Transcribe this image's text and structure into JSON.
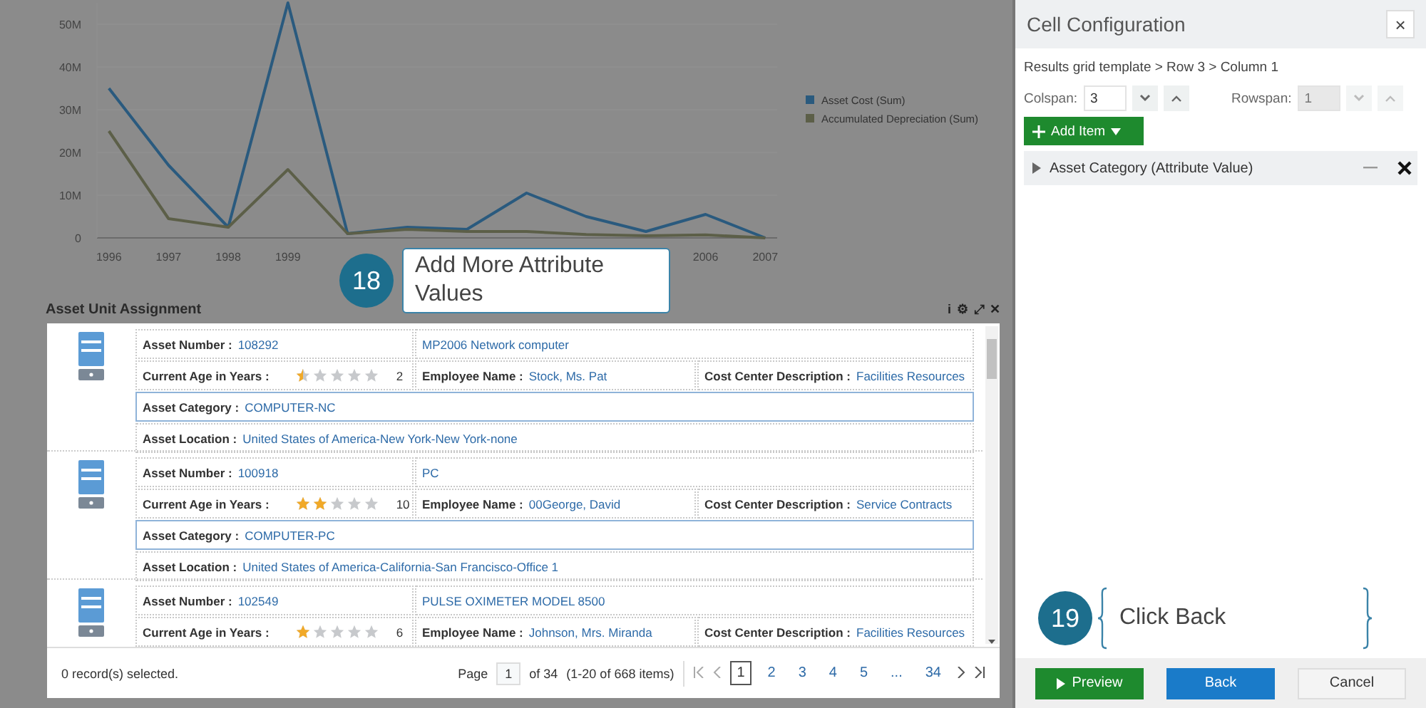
{
  "chart": {
    "chart_data": {
      "type": "line",
      "x": [
        1996,
        1997,
        1998,
        1999,
        2000,
        2001,
        2002,
        2003,
        2004,
        2005,
        2006,
        2007
      ],
      "xticks": [
        1996,
        1997,
        1998,
        1999,
        2006,
        2007
      ],
      "yticks": [
        {
          "value": 0,
          "label": "0"
        },
        {
          "value": 10,
          "label": "10M"
        },
        {
          "value": 20,
          "label": "20M"
        },
        {
          "value": 30,
          "label": "30M"
        },
        {
          "value": 40,
          "label": "40M"
        },
        {
          "value": 50,
          "label": "50M"
        }
      ],
      "xlim": [
        1995.8,
        2007.2
      ],
      "ylim": [
        0,
        55
      ],
      "legend": "right",
      "series": [
        {
          "name": "Asset Cost (Sum)",
          "color": "#2a5a7e",
          "values": [
            35,
            17,
            2.5,
            55,
            1,
            2.5,
            2,
            10.5,
            5,
            1.5,
            5.5,
            0
          ]
        },
        {
          "name": "Accumulated Depreciation (Sum)",
          "color": "#5c5f48",
          "values": [
            25,
            4.5,
            2.5,
            16,
            1,
            2,
            1.5,
            1.5,
            0.8,
            0.5,
            0.7,
            0
          ]
        }
      ]
    }
  },
  "callout_18": {
    "number": "18",
    "text": "Add More Attribute Values"
  },
  "panel": {
    "title": "Asset Unit Assignment",
    "tools": [
      "i",
      "⚙",
      "⤢",
      "✕"
    ],
    "cards": [
      {
        "asset_number": {
          "label": "Asset Number :",
          "value": "108292"
        },
        "description": "MP2006 Network computer",
        "age": {
          "label": "Current Age in Years :",
          "stars": 0.5,
          "value": "2"
        },
        "employee": {
          "label": "Employee Name :",
          "value": "Stock, Ms. Pat"
        },
        "cost_center": {
          "label": "Cost Center Description :",
          "value": "Facilities Resources"
        },
        "category": {
          "label": "Asset Category :",
          "value": "COMPUTER-NC",
          "selected": true
        },
        "location": {
          "label": "Asset Location :",
          "value": "United States of America-New York-New York-none"
        }
      },
      {
        "asset_number": {
          "label": "Asset Number :",
          "value": "100918"
        },
        "description": "PC",
        "age": {
          "label": "Current Age in Years :",
          "stars": 2,
          "value": "10"
        },
        "employee": {
          "label": "Employee Name :",
          "value": "00George, David"
        },
        "cost_center": {
          "label": "Cost Center Description :",
          "value": "Service Contracts"
        },
        "category": {
          "label": "Asset Category :",
          "value": "COMPUTER-PC",
          "selected": true
        },
        "location": {
          "label": "Asset Location :",
          "value": "United States of America-California-San Francisco-Office 1"
        }
      },
      {
        "asset_number": {
          "label": "Asset Number :",
          "value": "102549"
        },
        "description": "PULSE OXIMETER MODEL 8500",
        "age": {
          "label": "Current Age in Years :",
          "stars": 1,
          "value": "6"
        },
        "employee": {
          "label": "Employee Name :",
          "value": "Johnson, Mrs. Miranda"
        },
        "cost_center": {
          "label": "Cost Center Description :",
          "value": "Facilities Resources"
        }
      }
    ],
    "footer": {
      "selection": "0 record(s) selected.",
      "page_label": "Page",
      "page_value": "1",
      "of": "of 34",
      "range": "(1-20 of 668 items)",
      "pages": [
        {
          "label": "1",
          "selected": true
        },
        {
          "label": "2",
          "selected": false
        },
        {
          "label": "3",
          "selected": false
        },
        {
          "label": "4",
          "selected": false
        },
        {
          "label": "5",
          "selected": false
        },
        {
          "label": "...",
          "selected": false
        },
        {
          "label": "34",
          "selected": false
        }
      ]
    }
  },
  "dialog": {
    "title": "Cell Configuration",
    "close": "×",
    "breadcrumb": "Results grid template > Row 3 > Column 1",
    "colspan": {
      "label": "Colspan:",
      "value": "3",
      "disabled": false
    },
    "rowspan": {
      "label": "Rowspan:",
      "value": "1",
      "disabled": true
    },
    "add_item": "Add Item",
    "items": [
      {
        "label": "Asset Category (Attribute Value)",
        "expanded": false
      }
    ],
    "buttons": [
      {
        "kind": "preview",
        "label": "Preview"
      },
      {
        "kind": "primary",
        "label": "Back"
      },
      {
        "kind": "secondary",
        "label": "Cancel"
      }
    ]
  },
  "callout_19": {
    "number": "19",
    "text": "Click Back"
  }
}
